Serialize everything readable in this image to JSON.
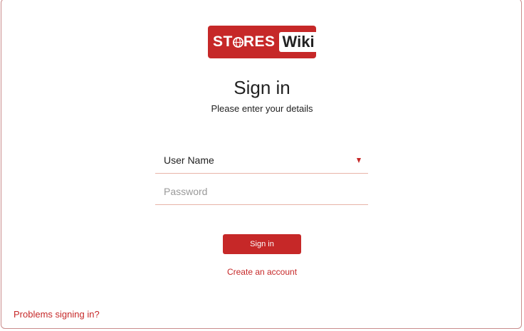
{
  "brand": {
    "stores_text_pre": "ST",
    "stores_text_post": "RES",
    "wiki_text": "Wiki",
    "primary_color": "#c62828"
  },
  "header": {
    "title": "Sign in",
    "subtitle": "Please enter your details"
  },
  "form": {
    "username": {
      "value": "User Name",
      "dropdown_icon": "caret-down-icon"
    },
    "password": {
      "placeholder": "Password"
    },
    "submit_label": "Sign in"
  },
  "links": {
    "create_account": "Create an account",
    "problems": "Problems signing in?"
  }
}
